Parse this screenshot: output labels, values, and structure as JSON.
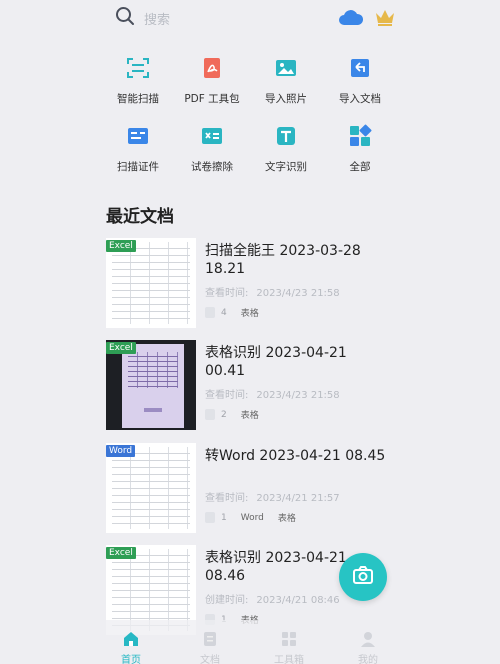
{
  "search": {
    "placeholder": "搜索"
  },
  "tools": [
    {
      "label": "智能扫描",
      "icon": "smart-scan-icon"
    },
    {
      "label": "PDF 工具包",
      "icon": "pdf-icon"
    },
    {
      "label": "导入照片",
      "icon": "import-photo-icon"
    },
    {
      "label": "导入文档",
      "icon": "import-document-icon"
    },
    {
      "label": "扫描证件",
      "icon": "id-card-icon"
    },
    {
      "label": "试卷擦除",
      "icon": "erase-icon"
    },
    {
      "label": "文字识别",
      "icon": "text-recognition-icon"
    },
    {
      "label": "全部",
      "icon": "all-apps-icon"
    }
  ],
  "recent": {
    "title": "最近文档",
    "docs": [
      {
        "badge": "Excel",
        "title": "扫描全能王 2023-03-28 18.21",
        "time_label": "查看时间:",
        "time": "2023/4/23 21:58",
        "pages": "4",
        "tags": [
          "表格"
        ]
      },
      {
        "badge": "Excel",
        "title": "表格识别 2023-04-21 00.41",
        "time_label": "查看时间:",
        "time": "2023/4/23 21:58",
        "pages": "2",
        "tags": [
          "表格"
        ]
      },
      {
        "badge": "Word",
        "title": "转Word 2023-04-21 08.45",
        "time_label": "查看时间:",
        "time": "2023/4/21 21:57",
        "pages": "1",
        "tags": [
          "Word",
          "表格"
        ]
      },
      {
        "badge": "Excel",
        "title": "表格识别 2023-04-21 08.46",
        "time_label": "创建时间:",
        "time": "2023/4/21 08:46",
        "pages": "1",
        "tags": [
          "表格"
        ]
      }
    ]
  },
  "nav": [
    {
      "label": "首页",
      "icon": "home-icon",
      "active": true
    },
    {
      "label": "文档",
      "icon": "documents-icon",
      "active": false
    },
    {
      "label": "工具箱",
      "icon": "toolbox-icon",
      "active": false
    },
    {
      "label": "我的",
      "icon": "profile-icon",
      "active": false
    }
  ],
  "colors": {
    "accent": "#27c4c4",
    "excel": "#2e9e55",
    "word": "#3a75d6"
  }
}
